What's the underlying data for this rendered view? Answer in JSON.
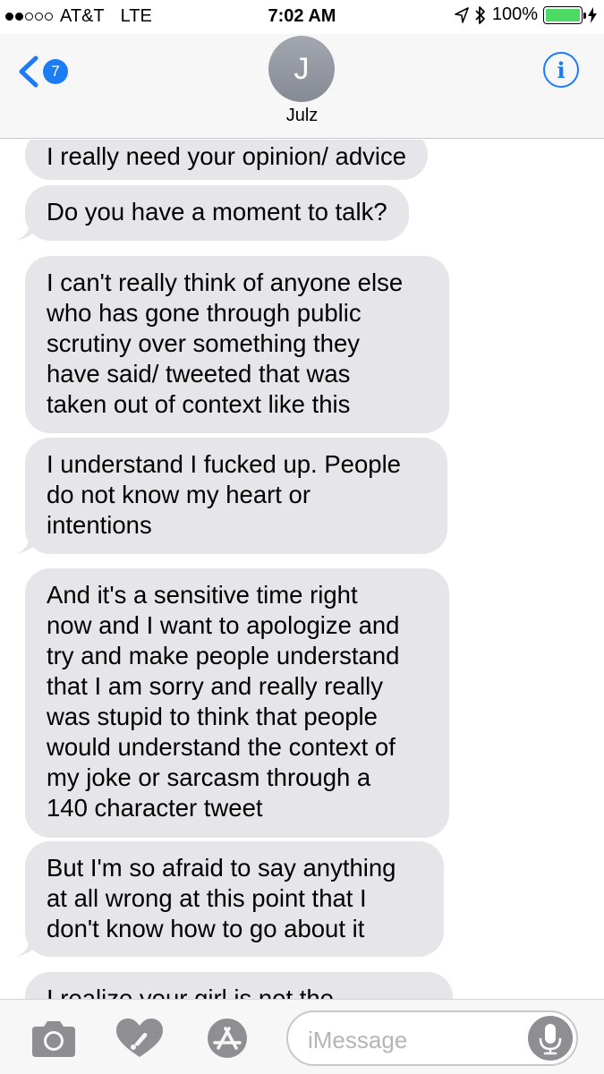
{
  "status_bar": {
    "carrier": "AT&T",
    "network": "LTE",
    "time": "7:02 AM",
    "battery_percent": "100%",
    "battery_level": 1.0,
    "signal_bars_filled": 2,
    "signal_bars_total": 5
  },
  "header": {
    "back_badge_count": "7",
    "avatar_initial": "J",
    "contact_name": "Julz",
    "info_icon_glyph": "i"
  },
  "messages": [
    {
      "text": "I really need your opinion/ advice"
    },
    {
      "text": "Do you have a moment to talk?"
    },
    {
      "text": "I can't really think of anyone else\nwho has gone through public\nscrutiny over something they\nhave said/ tweeted that was\ntaken out of context like this"
    },
    {
      "text": "I understand I fucked up. People\ndo not know my heart or\nintentions"
    },
    {
      "text": "And it's a sensitive time right\nnow and I want to apologize and\ntry and make people understand\nthat I am sorry and really really\nwas stupid to think that people\nwould understand the context of\nmy joke or sarcasm through a\n140 character tweet"
    },
    {
      "text": "But I'm so afraid to say anything\nat all wrong at this point that I\ndon't know how to go about it"
    },
    {
      "text": "I realize your girl is not the"
    }
  ],
  "composer": {
    "placeholder": "iMessage"
  },
  "colors": {
    "accent": "#1b7cf4",
    "incoming_bubble": "#e5e5ea",
    "battery": "#4cd964",
    "toolbar_icon": "#8e8e93"
  },
  "icons": [
    "camera-icon",
    "digital-touch-heart-icon",
    "app-store-icon",
    "microphone-icon",
    "location-arrow-icon",
    "bluetooth-icon",
    "charging-bolt-icon",
    "chevron-left-icon",
    "info-icon"
  ]
}
